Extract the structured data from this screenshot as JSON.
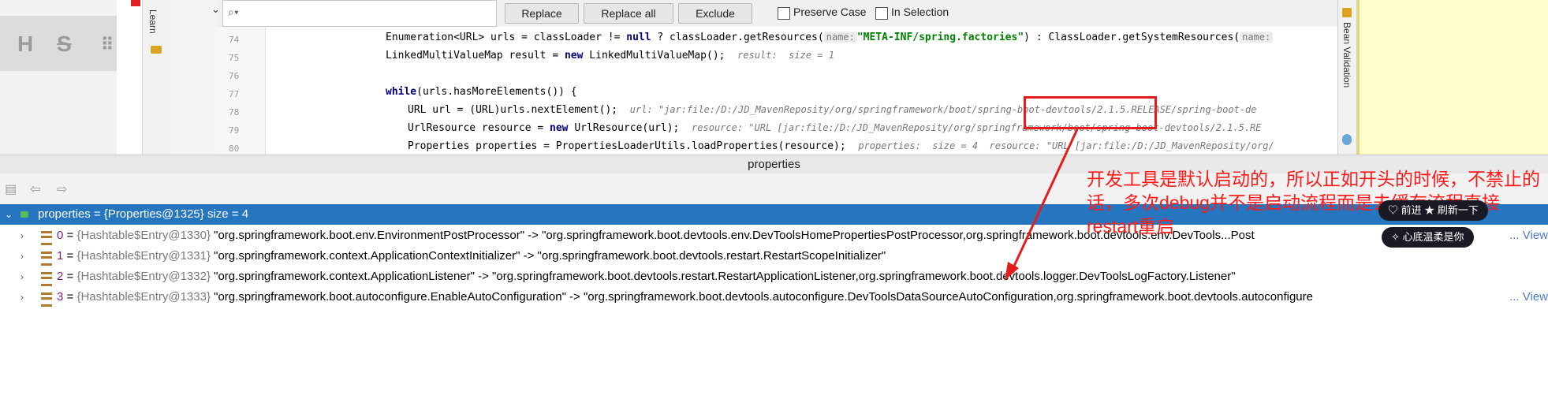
{
  "editor": {
    "learn_label": "Learn",
    "find_bar": {
      "search_value": "",
      "replace_label": "Replace",
      "replace_all_label": "Replace all",
      "exclude_label": "Exclude",
      "preserve_case_label": "Preserve Case",
      "in_selection_label": "In Selection"
    },
    "lines": [
      {
        "num": "74"
      },
      {
        "num": "75"
      },
      {
        "num": "76"
      },
      {
        "num": "77"
      },
      {
        "num": "78"
      },
      {
        "num": "79"
      },
      {
        "num": "80"
      }
    ],
    "code": {
      "l74a": "Enumeration<URL> urls = classLoader != ",
      "l74null": "null",
      "l74b": " ? classLoader.getResources(",
      "l74param": "name:",
      "l74str": "\"META-INF/spring.factories\"",
      "l74c": ") : ClassLoader.getSystemResources(",
      "l74param2": "name:",
      "l75a": "LinkedMultiValueMap result = ",
      "l75new": "new",
      "l75b": " LinkedMultiValueMap();",
      "l75hint": "result:  size = 1",
      "l77kw": "while",
      "l77a": "(urls.hasMoreElements()) {",
      "l78a": "URL url = (URL)urls.nextElement();",
      "l78hint": "url: \"jar:file:/D:/JD_MavenReposity/org/springframework/boot/spring-boot-devtools/2.1.5.RELEASE/spring-boot-de",
      "l79a": "UrlResource resource = ",
      "l79new": "new",
      "l79b": " UrlResource(url);",
      "l79hint": "resource: \"URL [jar:file:/D:/JD_MavenReposity/org/springframework/boot/spring-boot-devtools/2.1.5.RE",
      "l80a": "Properties properties = PropertiesLoaderUtils.loadProperties(resource);",
      "l80hint": "properties:  size = 4  resource: \"URL [jar:file:/D:/JD_MavenReposity/org/"
    },
    "bean_validation_label": "Bean Validation"
  },
  "debugger": {
    "panel_title": "properties",
    "root": {
      "name": "properties",
      "value": " = {Properties@1325}  size = 4"
    },
    "entries": [
      {
        "index": "0",
        "type": "{Hashtable$Entry@1330}",
        "value": "\"org.springframework.boot.env.EnvironmentPostProcessor\" -> \"org.springframework.boot.devtools.env.DevToolsHomePropertiesPostProcessor,org.springframework.boot.devtools.env.DevTools...Post",
        "view": "... View"
      },
      {
        "index": "1",
        "type": "{Hashtable$Entry@1331}",
        "value": "\"org.springframework.context.ApplicationContextInitializer\" -> \"org.springframework.boot.devtools.restart.RestartScopeInitializer\"",
        "view": ""
      },
      {
        "index": "2",
        "type": "{Hashtable$Entry@1332}",
        "value": "\"org.springframework.context.ApplicationListener\" -> \"org.springframework.boot.devtools.restart.RestartApplicationListener,org.springframework.boot.devtools.logger.DevToolsLogFactory.Listener\"",
        "view": ""
      },
      {
        "index": "3",
        "type": "{Hashtable$Entry@1333}",
        "value": "\"org.springframework.boot.autoconfigure.EnableAutoConfiguration\" -> \"org.springframework.boot.devtools.autoconfigure.DevToolsDataSourceAutoConfiguration,org.springframework.boot.devtools.autoconfigure",
        "view": "... View"
      }
    ]
  },
  "annotation": {
    "text": "开发工具是默认启动的，所以正如开头的时候，不禁止的话，多次debug并不是启动流程而是去缓存流程直接restart重启",
    "chip1": "♡ 前进 ★ 刷新一下",
    "chip2": "✧ 心底温柔是你"
  },
  "colors": {
    "selection": "#2675bf",
    "annotation_red": "#ff1a1a",
    "keyword": "#000080",
    "string": "#008000"
  }
}
